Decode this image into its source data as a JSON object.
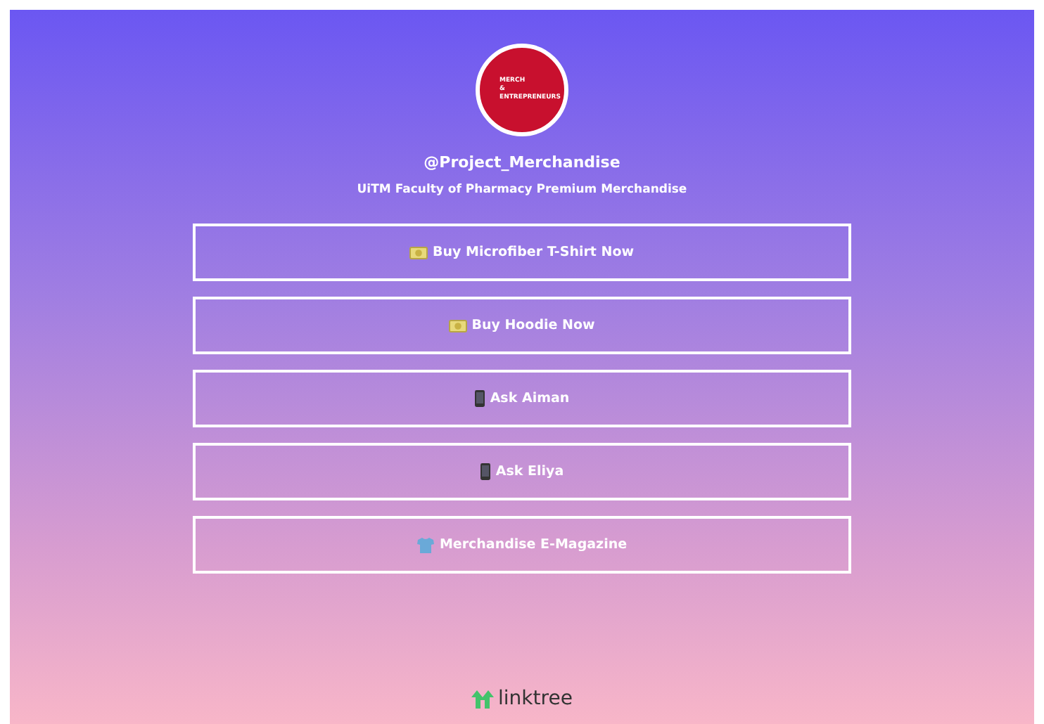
{
  "profile": {
    "logo": {
      "lines": [
        "MERCH",
        "&",
        "ENTREPRENEURS"
      ]
    },
    "handle": "@Project_Merchandise",
    "bio": "UiTM Faculty of Pharmacy Premium Merchandise"
  },
  "links": [
    {
      "kind": "money",
      "label": "Buy Microfiber T-Shirt Now"
    },
    {
      "kind": "money",
      "label": "Buy Hoodie Now"
    },
    {
      "kind": "phone",
      "label": "Ask Aiman"
    },
    {
      "kind": "phone",
      "label": "Ask Eliya"
    },
    {
      "kind": "shirt",
      "label": "Merchandise E-Magazine"
    }
  ],
  "footer": {
    "brand": "linktree"
  }
}
